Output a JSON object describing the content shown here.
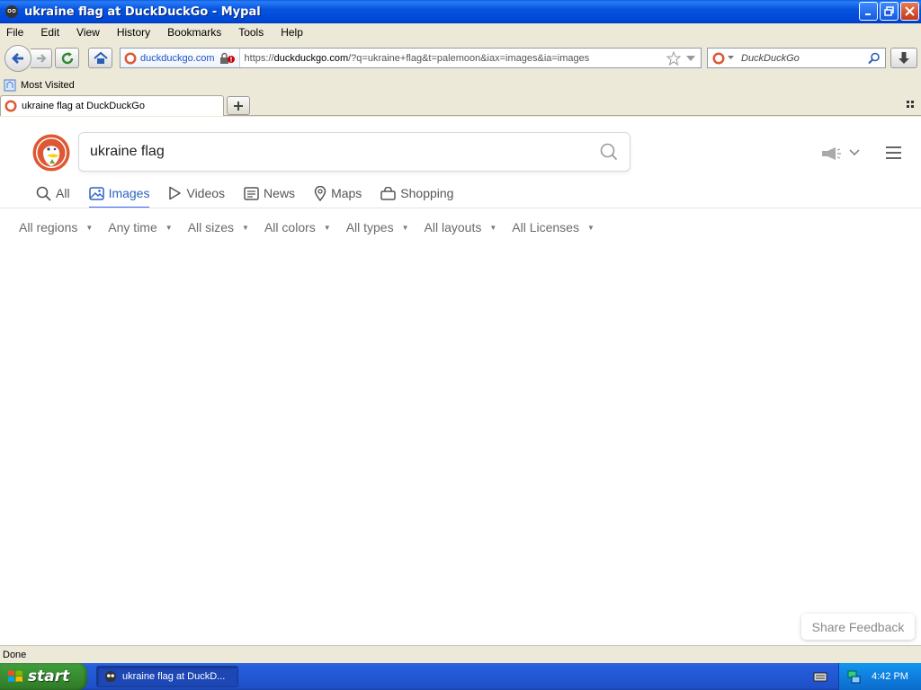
{
  "window": {
    "title": "ukraine flag at DuckDuckGo - Mypal"
  },
  "menubar": {
    "items": [
      "File",
      "Edit",
      "View",
      "History",
      "Bookmarks",
      "Tools",
      "Help"
    ]
  },
  "toolbar": {
    "identity_label": "duckduckgo.com",
    "url_prefix": "https://",
    "url_host": "duckduckgo.com",
    "url_path": "/?q=ukraine+flag&t=palemoon&iax=images&ia=images",
    "search_placeholder": "DuckDuckGo"
  },
  "bookmarks": {
    "items": [
      {
        "label": "Most Visited"
      }
    ]
  },
  "tabs": [
    {
      "label": "ukraine flag at DuckDuckGo",
      "active": true
    }
  ],
  "ddg": {
    "query": "ukraine flag",
    "tabs": [
      {
        "label": "All",
        "icon": "search-icon",
        "active": false
      },
      {
        "label": "Images",
        "icon": "image-icon",
        "active": true
      },
      {
        "label": "Videos",
        "icon": "play-icon",
        "active": false
      },
      {
        "label": "News",
        "icon": "news-icon",
        "active": false
      },
      {
        "label": "Maps",
        "icon": "map-pin-icon",
        "active": false
      },
      {
        "label": "Shopping",
        "icon": "shopping-bag-icon",
        "active": false
      }
    ],
    "filters": [
      {
        "label": "All regions"
      },
      {
        "label": "Any time"
      },
      {
        "label": "All sizes"
      },
      {
        "label": "All colors"
      },
      {
        "label": "All types"
      },
      {
        "label": "All layouts"
      },
      {
        "label": "All Licenses"
      }
    ],
    "share_feedback": "Share Feedback"
  },
  "statusbar": {
    "text": "Done"
  },
  "taskbar": {
    "start_label": "start",
    "task_label": "ukraine flag at DuckD...",
    "clock": "4:42 PM"
  },
  "colors": {
    "accent": "#3969ef",
    "ddg_orange": "#de5833",
    "xp_blue": "#245edb",
    "xp_green": "#3c9a38"
  }
}
